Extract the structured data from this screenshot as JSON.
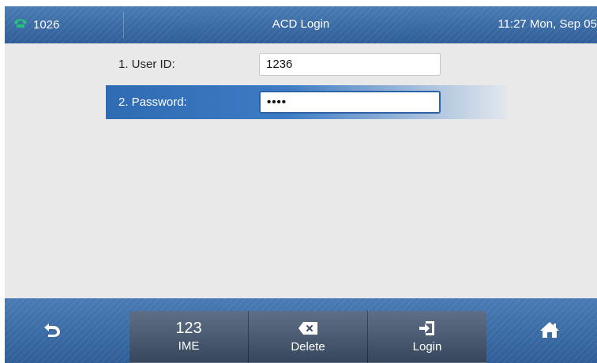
{
  "status_bar": {
    "extension": "1026",
    "title": "ACD Login",
    "datetime": "11:27 Mon, Sep 05"
  },
  "form": {
    "fields": [
      {
        "label": "1. User ID:",
        "value": "1236",
        "selected": false
      },
      {
        "label": "2. Password:",
        "value": "••••",
        "selected": true
      }
    ]
  },
  "softkeys": [
    {
      "top": "123",
      "label": "IME",
      "icon": "ime-icon"
    },
    {
      "label": "Delete",
      "icon": "backspace-icon"
    },
    {
      "label": "Login",
      "icon": "login-icon"
    }
  ],
  "nav": {
    "back_icon": "back-arrow-icon",
    "home_icon": "home-icon"
  },
  "colors": {
    "accent": "#3a69a3",
    "selected_row": "#2e6bb3",
    "phone_icon": "#27c17c"
  }
}
